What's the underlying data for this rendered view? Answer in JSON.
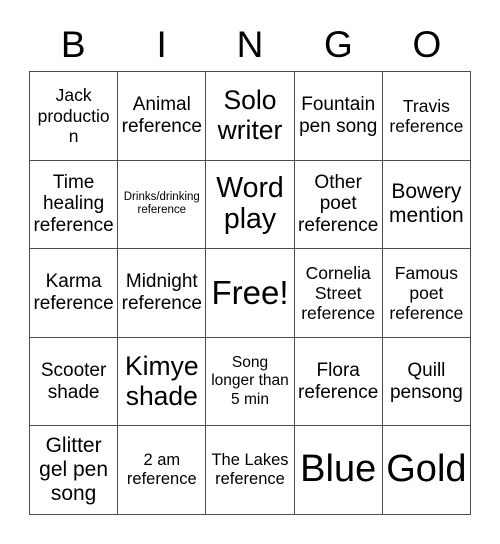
{
  "header": {
    "letters": [
      "B",
      "I",
      "N",
      "G",
      "O"
    ]
  },
  "grid": {
    "rows": 5,
    "columns": 5,
    "border_color": "#4d4d4d",
    "background_color": "#ffffff",
    "text_color": "#000000",
    "cells": [
      {
        "text": "Jack production",
        "size": "fs-m"
      },
      {
        "text": "Animal reference",
        "size": "fs-ml"
      },
      {
        "text": "Solo writer",
        "size": "fs-xl"
      },
      {
        "text": "Fountain pen song",
        "size": "fs-ml"
      },
      {
        "text": "Travis reference",
        "size": "fs-m"
      },
      {
        "text": "Time healing reference",
        "size": "fs-ml"
      },
      {
        "text": "Drinks/drinking reference",
        "size": "fs-xs"
      },
      {
        "text": "Word play",
        "size": "fs-xxl"
      },
      {
        "text": "Other poet reference",
        "size": "fs-ml"
      },
      {
        "text": "Bowery mention",
        "size": "fs-l"
      },
      {
        "text": "Karma reference",
        "size": "fs-ml"
      },
      {
        "text": "Midnight reference",
        "size": "fs-ml"
      },
      {
        "text": "Free!",
        "size": "fs-free"
      },
      {
        "text": "Cornelia Street reference",
        "size": "fs-m"
      },
      {
        "text": "Famous poet reference",
        "size": "fs-m"
      },
      {
        "text": "Scooter shade",
        "size": "fs-ml"
      },
      {
        "text": "Kimye shade",
        "size": "fs-xl"
      },
      {
        "text": "Song longer than 5 min",
        "size": "fs-s"
      },
      {
        "text": "Flora reference",
        "size": "fs-ml"
      },
      {
        "text": "Quill pensong",
        "size": "fs-ml"
      },
      {
        "text": "Glitter gel pen song",
        "size": "fs-l"
      },
      {
        "text": "2 am reference",
        "size": "fs-sm"
      },
      {
        "text": "The Lakes reference",
        "size": "fs-sm"
      },
      {
        "text": "Blue",
        "size": "fs-huge"
      },
      {
        "text": "Gold",
        "size": "fs-huge"
      }
    ]
  }
}
